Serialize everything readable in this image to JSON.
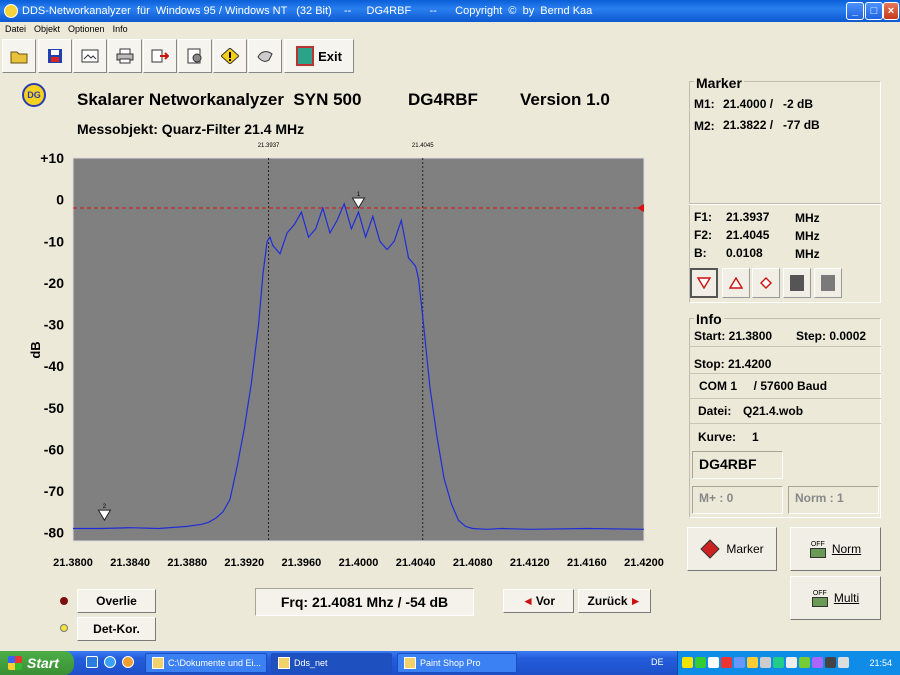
{
  "window": {
    "title": "DDS-Networkanalyzer  für  Windows 95 / Windows NT   (32 Bit)    --     DG4RBF      --      Copyright  ©  by  Bernd Kaa",
    "min_label": "_",
    "max_label": "□",
    "close_label": "×"
  },
  "menu": [
    "Datei",
    "Objekt",
    "Optionen",
    "Info"
  ],
  "toolbar": {
    "buttons": [
      "open-folder-icon",
      "save-disk-icon",
      "image-icon",
      "print-icon",
      "export-icon",
      "settings-icon",
      "warning-icon",
      "handshake-icon"
    ],
    "exit_label": "Exit"
  },
  "header": {
    "logo_text": "DG",
    "title": "Skalarer Networkanalyzer  SYN 500",
    "callsign": "DG4RBF",
    "version": "Version 1.0",
    "subtitle": "Messobjekt: Quarz-Filter 21.4 MHz"
  },
  "chart_data": {
    "type": "line",
    "ylabel": "dB",
    "xlim": [
      21.38,
      21.42
    ],
    "ylim": [
      -82,
      10
    ],
    "y_ticks": [
      "+10",
      "0",
      "-10",
      "-20",
      "-30",
      "-40",
      "-50",
      "-60",
      "-70",
      "-80"
    ],
    "y_tick_values": [
      10,
      0,
      -10,
      -20,
      -30,
      -40,
      -50,
      -60,
      -70,
      -80
    ],
    "x_ticks": [
      "21.3800",
      "21.3840",
      "21.3880",
      "21.3920",
      "21.3960",
      "21.4000",
      "21.4040",
      "21.4080",
      "21.4120",
      "21.4160",
      "21.4200"
    ],
    "x_tick_values": [
      21.38,
      21.384,
      21.388,
      21.392,
      21.396,
      21.4,
      21.404,
      21.408,
      21.412,
      21.416,
      21.42
    ],
    "cursor_lines": [
      21.3937,
      21.4045
    ],
    "cursor_labels": [
      "21.3937",
      "21.4045"
    ],
    "reference_level": -2,
    "markers": [
      {
        "label": "1",
        "x": 21.4,
        "y": -2
      },
      {
        "label": "2",
        "x": 21.3822,
        "y": -77
      }
    ],
    "series": [
      {
        "x": [
          21.38,
          21.382,
          21.384,
          21.386,
          21.388,
          21.389,
          21.3895,
          21.39,
          21.3905,
          21.391,
          21.3915,
          21.392,
          21.3925,
          21.393,
          21.3933,
          21.3936,
          21.3938,
          21.394,
          21.3945,
          21.395,
          21.3955,
          21.396,
          21.3965,
          21.397,
          21.3975,
          21.398,
          21.3985,
          21.399,
          21.3995,
          21.4,
          21.4005,
          21.401,
          21.4015,
          21.402,
          21.4025,
          21.403,
          21.4035,
          21.404,
          21.4042,
          21.4045,
          21.405,
          21.4055,
          21.406,
          21.4065,
          21.407,
          21.4075,
          21.408,
          21.409,
          21.41,
          21.412,
          21.416,
          21.42
        ],
        "y": [
          -79,
          -79,
          -78.8,
          -79,
          -78.5,
          -78,
          -77.5,
          -76.5,
          -75,
          -72,
          -64,
          -55,
          -44,
          -30,
          -18,
          -10,
          -9,
          -11,
          -13,
          -8,
          -6,
          -3,
          -9,
          -7,
          -2,
          -8,
          -5,
          -1,
          -7,
          -3,
          -9,
          -4,
          -10,
          -12,
          -10,
          -5,
          -14,
          -16,
          -19,
          -28,
          -45,
          -57,
          -67,
          -73,
          -77,
          -78.5,
          -79,
          -79.2,
          -79,
          -79.2,
          -79,
          -79.2
        ]
      }
    ]
  },
  "marker_panel": {
    "title": "Marker",
    "m1_label": "M1:",
    "m1_value": "21.4000 /   -2 dB",
    "m2_label": "M2:",
    "m2_value": "21.3822 /   -77 dB",
    "f1_label": "F1:",
    "f1_value": "21.3937",
    "f2_label": "F2:",
    "f2_value": "21.4045",
    "b_label": "B:",
    "b_value": "0.0108",
    "unit": "MHz",
    "tools": [
      "marker-down-icon",
      "marker-up-icon",
      "diamond-icon",
      "square-dark-icon",
      "square-grey-icon"
    ]
  },
  "info_panel": {
    "title": "Info",
    "start": "Start: 21.3800",
    "step": "Step: 0.0002",
    "stop": "Stop: 21.4200",
    "com": "COM 1     / 57600 Baud",
    "datei_label": "Datei:",
    "datei_value": "Q21.4.wob",
    "kurve_label": "Kurve:",
    "kurve_value": "1",
    "callsign": "DG4RBF",
    "mplus": "M+ :   0",
    "norm": "Norm : 1"
  },
  "buttons": {
    "marker": "Marker",
    "norm": "Norm",
    "multi": "Multi",
    "off_label": "OFF",
    "overlie": "Overlie",
    "detkor": "Det-Kor.",
    "vor": "Vor",
    "zurueck": "Zurück"
  },
  "status": {
    "freq_readout": "Frq: 21.4081 Mhz   /  -54 dB"
  },
  "colors": {
    "plot_bg": "#808080",
    "trace": "#1f2dd8",
    "reference": "#dd1111",
    "led_overlie": "#7a1010",
    "led_detkor": "#f2e43a"
  },
  "taskbar": {
    "start": "Start",
    "tasks": [
      "C:\\Dokumente und Ei...",
      "Dds_net",
      "Paint Shop Pro"
    ],
    "lang": "DE",
    "clock": "21:54"
  }
}
